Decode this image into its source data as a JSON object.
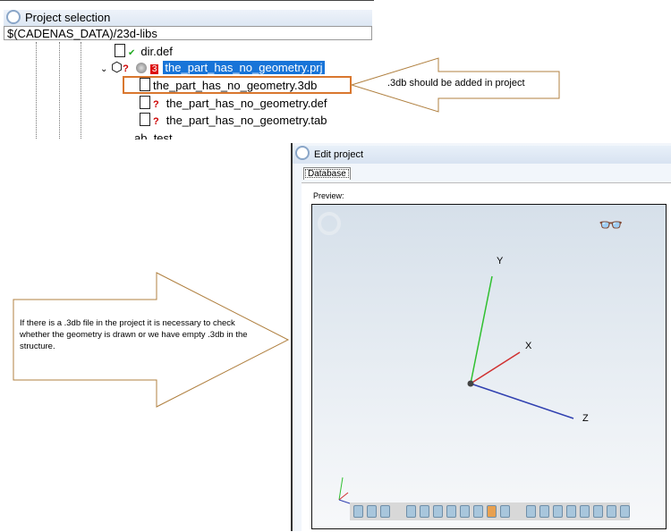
{
  "project_selection": {
    "title": "Project selection",
    "path": "$(CADENAS_DATA)/23d-libs",
    "items": [
      {
        "label": "dir.def",
        "status": "check"
      },
      {
        "label": "the_part_has_no_geometry.prj",
        "badge": "3",
        "status": "?"
      },
      {
        "label": "the_part_has_no_geometry.3db"
      },
      {
        "label": "the_part_has_no_geometry.def",
        "status": "?"
      },
      {
        "label": "the_part_has_no_geometry.tab",
        "status": "?"
      },
      {
        "label": "ab_test"
      }
    ]
  },
  "callouts": {
    "top": ".3db should be added in project",
    "left": "If there is a .3db file in the project it is necessary to check whether the geometry is drawn or we have empty .3db in the structure."
  },
  "edit_project": {
    "title": "Edit project",
    "tab": "Database",
    "preview_label": "Preview:",
    "axes": {
      "x": "X",
      "y": "Y",
      "z": "Z"
    }
  },
  "colors": {
    "highlight": "#d9772e",
    "selection": "#1874d8",
    "axis_x": "#d03030",
    "axis_y": "#30c030",
    "axis_z": "#3040b0"
  }
}
